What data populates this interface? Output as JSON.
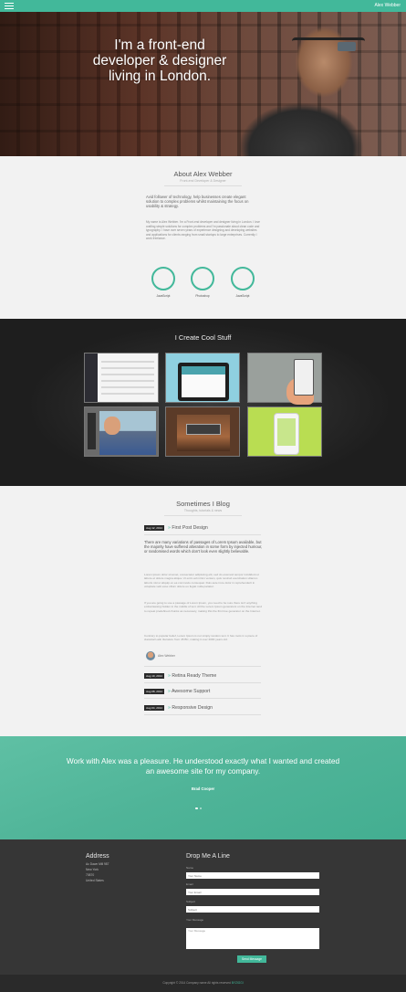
{
  "topbar": {
    "link": "Alex Webber",
    "accent": "#42b89a"
  },
  "hero": {
    "title": "I'm a front-end developer & designer living in London."
  },
  "about": {
    "title": "About Alex Webber",
    "subtitle": "Front-end Developer & Designer",
    "lead": "Avid follower of technology, help businesses create elegant solution to complex problems whilst maintaining the focus on usability & strategy.",
    "text": "My name is Alex Webber. I'm a Front-end developer and designer living in London. I love crafting simple solutions for complex problems and I'm passionate about clean code and typography. I have over seven years of experience designing and developing websites and applications for clients ranging from small startups to large enterprises. Currently I work freelance.",
    "skills": [
      {
        "label": "JavaScript"
      },
      {
        "label": "Photoshop"
      },
      {
        "label": "JavaScript"
      }
    ]
  },
  "work": {
    "title": "I Create Cool Stuff"
  },
  "blog": {
    "title": "Sometimes I Blog",
    "subtitle": "Thoughts, tutorials & news",
    "featured": {
      "date": "Aug 12, 2014",
      "title": "First Post Design",
      "lead": "There are many variations of passages of Lorem Ipsum available, but the majority have suffered alteration in some form by injected humour, or randomised words which don't look even slightly believable.",
      "para1": "Lorem ipsum dolor sit amet, consectetur adipiscing elit, sed do eiusmod tempor incididunt ut labore et dolore magna aliqua. Ut enim ad minim veniam, quis nostrud exercitation ullamco laboris nisi ut aliquip ex ea commodo consequat. Duis aute irure dolor in reprehenderit in voluptate velit esse cillum dolore eu fugiat nulla pariatur.",
      "para2": "If you are going to use a passage of Lorem Ipsum, you need to be sure there isn't anything embarrassing hidden in the middle of text. All the Lorem Ipsum generators on the Internet tend to repeat predefined chunks as necessary, making this the first true generator on the Internet.",
      "para3": "Contrary to popular belief, Lorem Ipsum is not simply random text. It has roots in a piece of classical Latin literature from 45 BC, making it over 2000 years old.",
      "author": "Alex Webber"
    },
    "posts": [
      {
        "date": "Aug 10, 2014",
        "title": "Retina Ready Theme"
      },
      {
        "date": "Aug 08, 2014",
        "title": "Awesome Support"
      },
      {
        "date": "Aug 04, 2014",
        "title": "Responsive Design"
      }
    ]
  },
  "testimonial": {
    "quote": "Work with Alex was a pleasure. He understood exactly what I wanted and created an awesome site for my company.",
    "author": "Brad Cooper"
  },
  "footer": {
    "address_heading": "Address",
    "address_lines": [
      "Ac Dawn Mill 987",
      "New York",
      "70870",
      "United States"
    ],
    "form_heading": "Drop Me A Line",
    "labels": {
      "name": "Name",
      "email": "Email",
      "subject": "Subject",
      "message": "Your Message"
    },
    "placeholders": {
      "name": "Your Name",
      "email": "Your Email",
      "subject": "Subject",
      "message": "Your Message"
    },
    "send": "Send Message",
    "copyright_prefix": "Copyright © 2014 Company name All rights reserved",
    "copyright_accent": "BYZIGGI"
  }
}
